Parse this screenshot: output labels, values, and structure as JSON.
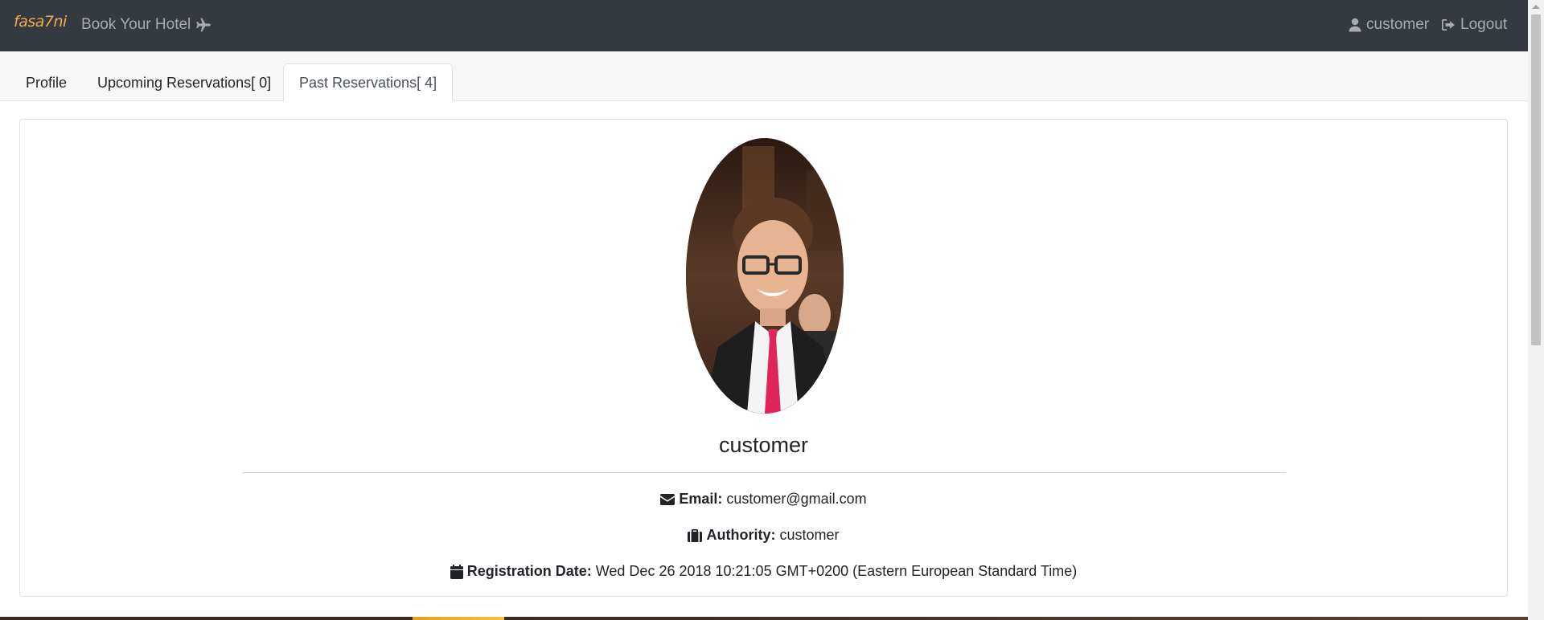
{
  "navbar": {
    "brand": "fasa7ni",
    "book_link": "Book Your Hotel",
    "user_link": "customer",
    "logout_link": "Logout"
  },
  "tabs": [
    {
      "label": "Profile"
    },
    {
      "label": "Upcoming Reservations[ 0]"
    },
    {
      "label": "Past Reservations[ 4]"
    }
  ],
  "profile": {
    "username": "customer",
    "email_label": "Email:",
    "email_value": "customer@gmail.com",
    "authority_label": "Authority:",
    "authority_value": "customer",
    "regdate_label": "Registration Date:",
    "regdate_value": "Wed Dec 26 2018 10:21:05 GMT+0200 (Eastern European Standard Time)"
  },
  "icons": {
    "plane": "plane-icon",
    "user": "user-icon",
    "logout": "sign-out-icon",
    "email": "envelope-icon",
    "authority": "briefcase-icon",
    "regdate": "calendar-icon"
  },
  "colors": {
    "navbar_bg": "#343a40",
    "brand": "#f0ad4e",
    "nav_text": "#a8abae"
  }
}
